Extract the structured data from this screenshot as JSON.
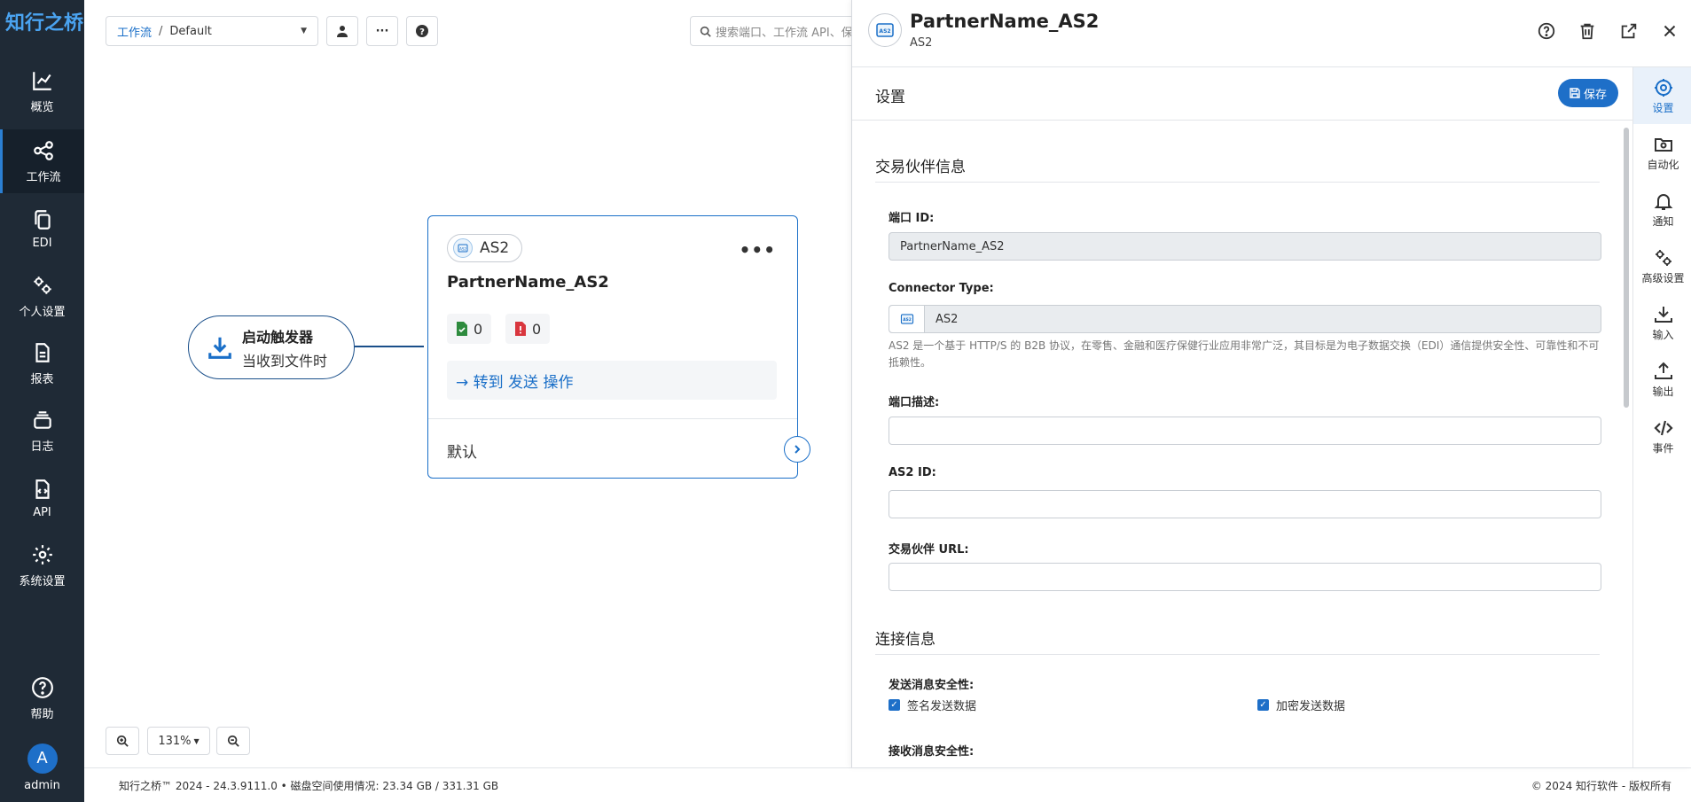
{
  "app": {
    "logo": "知行之桥"
  },
  "sidebar": {
    "items": [
      {
        "label": "概览",
        "icon": "chart-line-icon"
      },
      {
        "label": "工作流",
        "icon": "share-nodes-icon",
        "active": true
      },
      {
        "label": "EDI",
        "icon": "copy-icon"
      },
      {
        "label": "个人设置",
        "icon": "gears-icon"
      },
      {
        "label": "报表",
        "icon": "file-lines-icon"
      },
      {
        "label": "日志",
        "icon": "layers-icon"
      },
      {
        "label": "API",
        "icon": "file-code-icon"
      },
      {
        "label": "系统设置",
        "icon": "gear-icon"
      }
    ],
    "help_label": "帮助",
    "user": {
      "initial": "A",
      "name": "admin"
    }
  },
  "toolbar": {
    "breadcrumb_link": "工作流",
    "breadcrumb_sep": "/",
    "breadcrumb_current": "Default",
    "search_placeholder": "搜索端口、工作流 API、保"
  },
  "workflow": {
    "trigger": {
      "title": "启动触发器",
      "subtitle": "当收到文件时"
    },
    "node": {
      "type_label": "AS2",
      "more": "•••",
      "title": "PartnerName_AS2",
      "success_count": "0",
      "error_count": "0",
      "action_text": "→ 转到 发送 操作",
      "default_label": "默认"
    }
  },
  "zoom": {
    "level": "131%"
  },
  "footer": {
    "version": "知行之桥™ 2024 - 24.3.9111.0 • 磁盘空间使用情况: 23.34 GB / 331.31 GB",
    "copyright": "© 2024 知行软件 - 版权所有"
  },
  "panel": {
    "title": "PartnerName_AS2",
    "subtitle": "AS2",
    "settings_title": "设置",
    "save_label": "保存",
    "sections": {
      "partner_info": "交易伙伴信息",
      "connection_info": "连接信息"
    },
    "fields": {
      "port_id_label": "端口 ID:",
      "port_id_value": "PartnerName_AS2",
      "connector_type_label": "Connector Type:",
      "connector_type_value": "AS2",
      "connector_help": "AS2 是一个基于 HTTP/S 的 B2B 协议，在零售、金融和医疗保健行业应用非常广泛，其目标是为电子数据交换（EDI）通信提供安全性、可靠性和不可抵赖性。",
      "port_desc_label": "端口描述:",
      "as2_id_label": "AS2 ID:",
      "partner_url_label": "交易伙伴 URL:",
      "send_security_label": "发送消息安全性:",
      "sign_label": "签名发送数据",
      "encrypt_label": "加密发送数据",
      "receive_security_label": "接收消息安全性:"
    },
    "tabs": [
      {
        "label": "设置",
        "icon": "gear-icon",
        "active": true
      },
      {
        "label": "自动化",
        "icon": "folder-gear-icon"
      },
      {
        "label": "通知",
        "icon": "bell-icon"
      },
      {
        "label": "高级设置",
        "icon": "gears-icon"
      },
      {
        "label": "输入",
        "icon": "download-icon"
      },
      {
        "label": "输出",
        "icon": "upload-icon"
      },
      {
        "label": "事件",
        "icon": "code-icon"
      }
    ]
  },
  "colors": {
    "accent": "#1e6fc8",
    "sidebar": "#1f2a36",
    "success": "#2e8b3e",
    "error": "#d9363e"
  }
}
